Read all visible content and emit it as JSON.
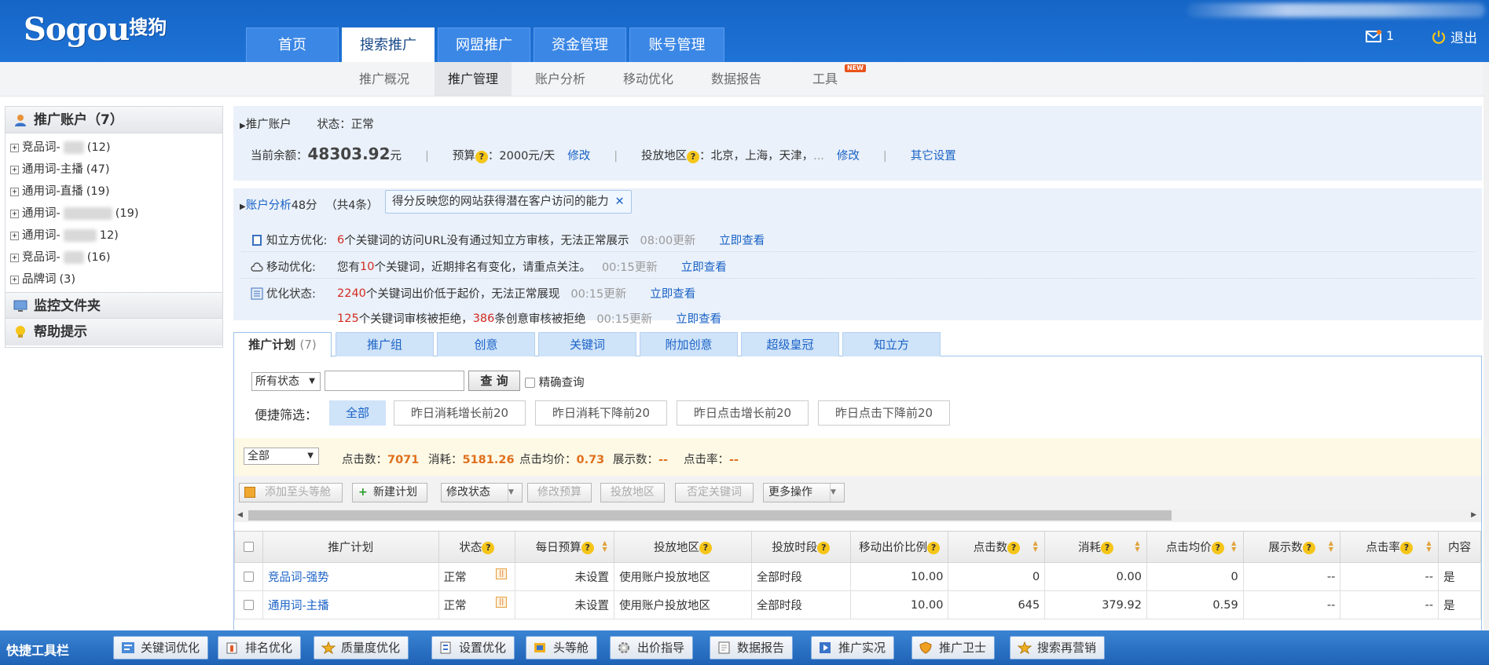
{
  "logo": {
    "en": "Sogou",
    "cn": "搜狗"
  },
  "main_nav": [
    "首页",
    "搜索推广",
    "网盟推广",
    "资金管理",
    "账号管理"
  ],
  "main_nav_active": "搜索推广",
  "header": {
    "mail_count": "1",
    "logout": "退出"
  },
  "sub_nav": [
    "推广概况",
    "推广管理",
    "账户分析",
    "移动优化",
    "数据报告",
    "工具"
  ],
  "sub_nav_active": "推广管理",
  "new_badge": "NEW",
  "left": {
    "account_title": "推广账户（7）",
    "items": [
      {
        "label": "竞品词-",
        "count": "(12)"
      },
      {
        "label": "通用词-主播",
        "count": "(47)"
      },
      {
        "label": "通用词-直播",
        "count": "(19)"
      },
      {
        "label": "通用词-",
        "count": "(19)"
      },
      {
        "label": "通用词-",
        "count": "12)"
      },
      {
        "label": "竞品词-",
        "count": "(16)"
      },
      {
        "label": "品牌词",
        "count": "(3)"
      }
    ],
    "monitor_title": "监控文件夹",
    "help_title": "帮助提示"
  },
  "account": {
    "label": "推广账户",
    "status": "状态：正常",
    "balance_label": "当前余额：",
    "balance": "48303.92",
    "balance_unit": "元",
    "budget_label": "预算",
    "budget_value": "：2000元/天",
    "modify": "修改",
    "region_label": "投放地区",
    "region_value": "：北京，上海，天津，",
    "ellipsis": "...",
    "other": "其它设置"
  },
  "analysis": {
    "title": "账户分析",
    "score": "48分",
    "count": "（共4条）",
    "tip": "得分反映您的网站获得潜在客户访问的能力",
    "close": "✕",
    "rows": [
      {
        "label": "知立方优化:",
        "pre": "",
        "n1": "6",
        "mid": " 个关键词的访问URL没有通过知立方审核，无法正常展示",
        "n2": "",
        "post": "",
        "time": "08:00更新",
        "link": "立即查看"
      },
      {
        "label": "移动优化:",
        "pre": "您有",
        "n1": "10",
        "mid": "个关键词，近期排名有变化，请重点关注。",
        "n2": "",
        "post": "",
        "time": "00:15更新",
        "link": "立即查看"
      },
      {
        "label": "优化状态:",
        "pre": "",
        "n1": "2240",
        "mid": "个关键词出价低于起价，无法正常展现",
        "n2": "",
        "post": "",
        "time": "00:15更新",
        "link": "立即查看"
      },
      {
        "label": "",
        "pre": "",
        "n1": "125",
        "mid": "个关键词审核被拒绝，",
        "n2": "386",
        "post": "条创意审核被拒绝",
        "time": "00:15更新",
        "link": "立即查看"
      }
    ]
  },
  "tabs": [
    "推广计划",
    "推广组",
    "创意",
    "关键词",
    "附加创意",
    "超级皇冠",
    "知立方"
  ],
  "tab_count": "(7)",
  "search": {
    "status": "所有状态",
    "query_btn": "查 询",
    "exact": "精确查询",
    "value": ""
  },
  "quick": {
    "label": "便捷筛选：",
    "filters": [
      "全部",
      "昨日消耗增长前20",
      "昨日消耗下降前20",
      "昨日点击增长前20",
      "昨日点击下降前20"
    ]
  },
  "stats": {
    "scope": "全部",
    "clicks_label": "点击数：",
    "clicks": "7071",
    "cost_label": "消耗：",
    "cost": "5181.26",
    "cpc_label": "点击均价：",
    "cpc": "0.73",
    "impr_label": "展示数：",
    "impr": "--",
    "ctr_label": "点击率：",
    "ctr": "--"
  },
  "actions": [
    "添加至头等舱",
    "新建计划",
    "修改状态",
    "修改预算",
    "投放地区",
    "否定关键词",
    "更多操作"
  ],
  "table": {
    "headers": [
      "推广计划",
      "状态",
      "每日预算",
      "投放地区",
      "投放时段",
      "移动出价比例",
      "点击数",
      "消耗",
      "点击均价",
      "展示数",
      "点击率",
      "内容"
    ],
    "rows": [
      [
        "竞品词-强势",
        "正常",
        "未设置",
        "使用账户投放地区",
        "全部时段",
        "10.00",
        "0",
        "0.00",
        "0",
        "--",
        "--",
        "是"
      ],
      [
        "通用词-主播",
        "正常",
        "未设置",
        "使用账户投放地区",
        "全部时段",
        "10.00",
        "645",
        "379.92",
        "0.59",
        "--",
        "--",
        "是"
      ]
    ]
  },
  "toolbar": {
    "title": "快捷工具栏",
    "buttons": [
      "关键词优化",
      "排名优化",
      "质量度优化",
      "设置优化",
      "头等舱",
      "出价指导",
      "数据报告",
      "推广实况",
      "推广卫士",
      "搜索再营销"
    ]
  }
}
